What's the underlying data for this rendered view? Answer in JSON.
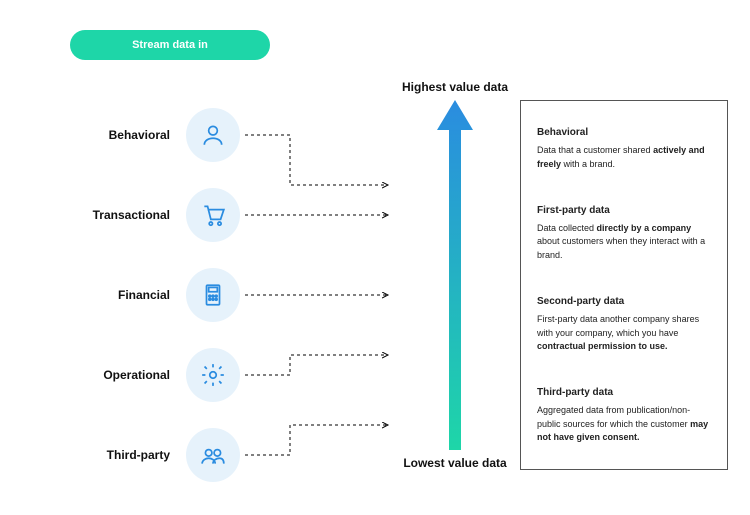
{
  "button": {
    "label": "Stream data in"
  },
  "categories": [
    {
      "label": "Behavioral",
      "icon": "user-icon"
    },
    {
      "label": "Transactional",
      "icon": "cart-icon"
    },
    {
      "label": "Financial",
      "icon": "calculator-icon"
    },
    {
      "label": "Operational",
      "icon": "gear-icon"
    },
    {
      "label": "Third-party",
      "icon": "group-icon"
    }
  ],
  "arrow": {
    "top_label": "Highest value data",
    "bottom_label": "Lowest value data"
  },
  "definitions": [
    {
      "title": "Behavioral",
      "body_before": "Data that a customer shared ",
      "bold": "actively and freely",
      "body_after": " with a brand."
    },
    {
      "title": "First-party data",
      "body_before": "Data collected ",
      "bold": "directly by a company",
      "body_after": " about customers when they interact with a brand."
    },
    {
      "title": "Second-party data",
      "body_before": "First-party data another company shares with your company, which you have ",
      "bold": "contractual permission to use.",
      "body_after": ""
    },
    {
      "title": "Third-party data",
      "body_before": "Aggregated data from publication/non-public sources for which the customer ",
      "bold": "may not have given consent.",
      "body_after": ""
    }
  ]
}
